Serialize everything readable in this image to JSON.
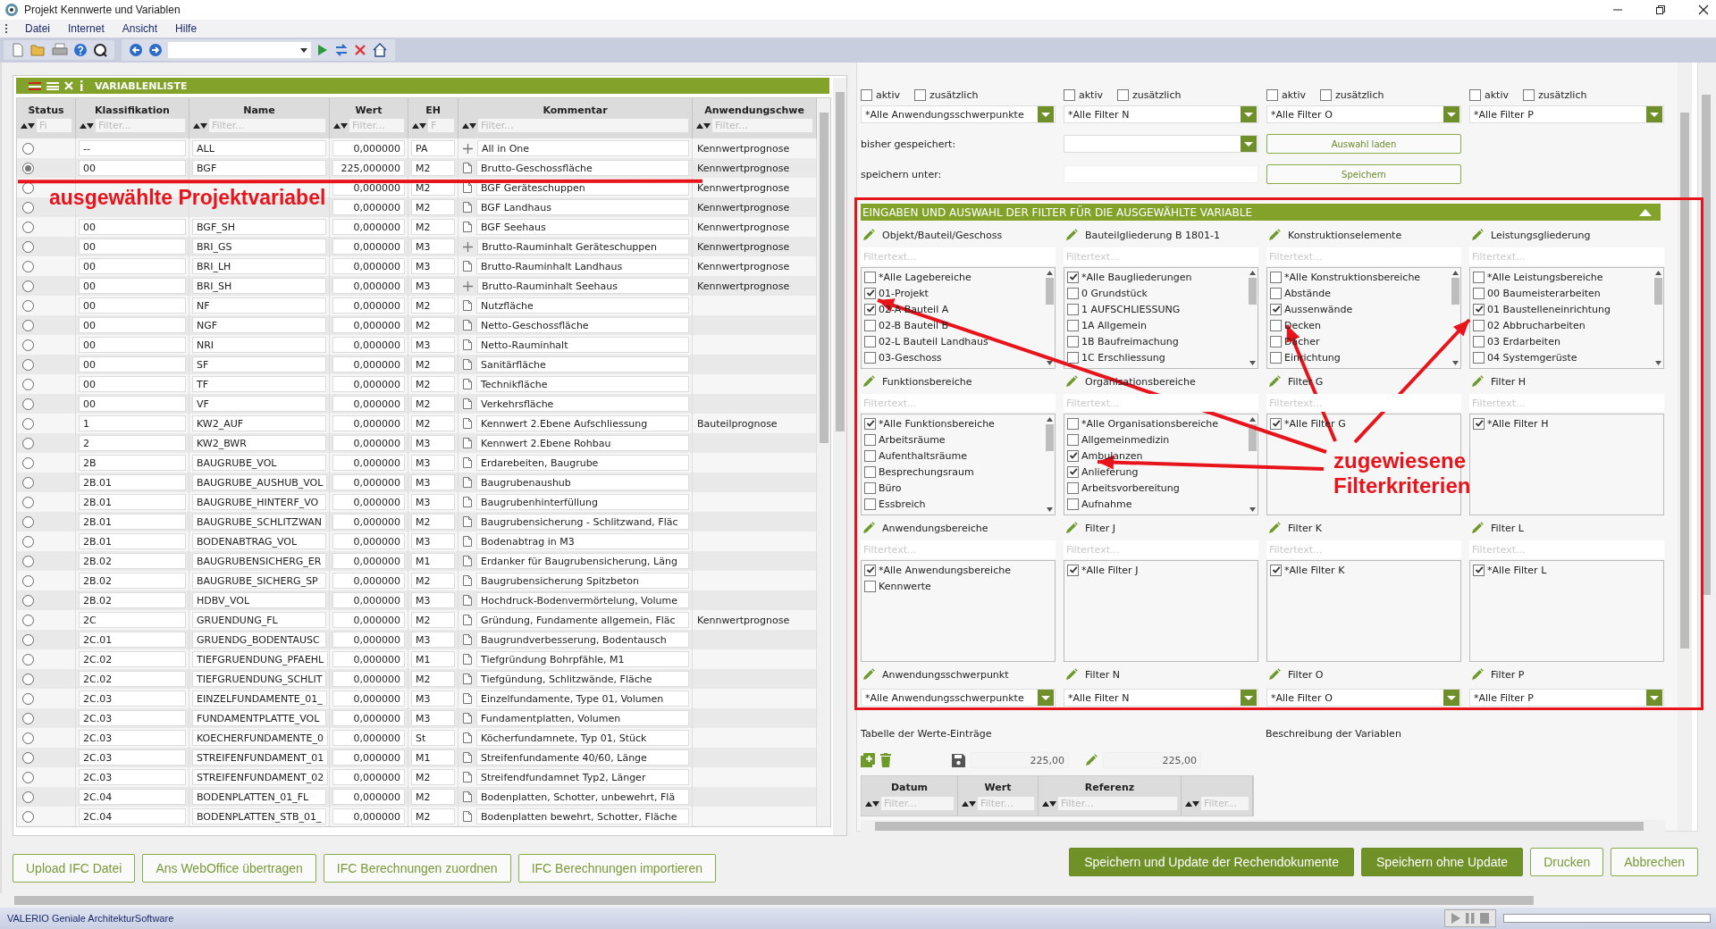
{
  "window": {
    "title": "Projekt Kennwerte und Variablen"
  },
  "menu": [
    "Datei",
    "Internet",
    "Ansicht",
    "Hilfe"
  ],
  "variable_list": {
    "title": "VARIABLENLISTE",
    "columns": [
      {
        "label": "Status",
        "placeholder": "Fi"
      },
      {
        "label": "Klassifikation",
        "placeholder": "Filter..."
      },
      {
        "label": "Name",
        "placeholder": "Filter..."
      },
      {
        "label": "Wert",
        "placeholder": "Filter..."
      },
      {
        "label": "EH",
        "placeholder": "F"
      },
      {
        "label": "Kommentar",
        "placeholder": "Filter..."
      },
      {
        "label": "Anwendungschwe",
        "placeholder": "Filter..."
      }
    ],
    "rows": [
      {
        "selected": false,
        "classification": "--",
        "name": "ALL",
        "value": "0,000000",
        "unit": "PA",
        "kind": "plus",
        "comment": "All in One",
        "application": "Kennwertprognose"
      },
      {
        "selected": true,
        "classification": "00",
        "name": "BGF",
        "value": "225,000000",
        "unit": "M2",
        "kind": "page",
        "comment": "Brutto-Geschossfläche",
        "application": "Kennwertprognose"
      },
      {
        "selected": false,
        "value": "0,000000",
        "unit": "M2",
        "kind": "page",
        "comment": "BGF Geräteschuppen",
        "application": "Kennwertprognose"
      },
      {
        "selected": false,
        "value": "0,000000",
        "unit": "M2",
        "kind": "page",
        "comment": "BGF Landhaus",
        "application": "Kennwertprognose"
      },
      {
        "selected": false,
        "classification": "00",
        "name": "BGF_SH",
        "value": "0,000000",
        "unit": "M2",
        "kind": "page",
        "comment": "BGF Seehaus",
        "application": "Kennwertprognose"
      },
      {
        "selected": false,
        "classification": "00",
        "name": "BRI_GS",
        "value": "0,000000",
        "unit": "M3",
        "kind": "plus",
        "comment": "Brutto-Rauminhalt Geräteschuppen",
        "application": "Kennwertprognose"
      },
      {
        "selected": false,
        "classification": "00",
        "name": "BRI_LH",
        "value": "0,000000",
        "unit": "M3",
        "kind": "page",
        "comment": "Brutto-Rauminhalt Landhaus",
        "application": "Kennwertprognose"
      },
      {
        "selected": false,
        "classification": "00",
        "name": "BRI_SH",
        "value": "0,000000",
        "unit": "M3",
        "kind": "plus",
        "comment": "Brutto-Rauminhalt Seehaus",
        "application": "Kennwertprognose"
      },
      {
        "selected": false,
        "classification": "00",
        "name": "NF",
        "value": "0,000000",
        "unit": "M2",
        "kind": "page",
        "comment": "Nutzfläche"
      },
      {
        "selected": false,
        "classification": "00",
        "name": "NGF",
        "value": "0,000000",
        "unit": "M2",
        "kind": "page",
        "comment": "Netto-Geschossfläche"
      },
      {
        "selected": false,
        "classification": "00",
        "name": "NRI",
        "value": "0,000000",
        "unit": "M3",
        "kind": "page",
        "comment": "Netto-Rauminhalt"
      },
      {
        "selected": false,
        "classification": "00",
        "name": "SF",
        "value": "0,000000",
        "unit": "M2",
        "kind": "page",
        "comment": "Sanitärfläche"
      },
      {
        "selected": false,
        "classification": "00",
        "name": "TF",
        "value": "0,000000",
        "unit": "M2",
        "kind": "page",
        "comment": "Technikfläche"
      },
      {
        "selected": false,
        "classification": "00",
        "name": "VF",
        "value": "0,000000",
        "unit": "M2",
        "kind": "page",
        "comment": "Verkehrsfläche"
      },
      {
        "selected": false,
        "classification": "1",
        "name": "KW2_AUF",
        "value": "0,000000",
        "unit": "M2",
        "kind": "page",
        "comment": "Kennwert 2.Ebene Aufschliessung",
        "application": "Bauteilprognose"
      },
      {
        "selected": false,
        "classification": "2",
        "name": "KW2_BWR",
        "value": "0,000000",
        "unit": "M3",
        "kind": "page",
        "comment": "Kennwert 2.Ebene Rohbau"
      },
      {
        "selected": false,
        "classification": "2B",
        "name": "BAUGRUBE_VOL",
        "value": "0,000000",
        "unit": "M3",
        "kind": "page",
        "comment": "Erdarebeiten, Baugrube"
      },
      {
        "selected": false,
        "classification": "2B.01",
        "name": "BAUGRUBE_AUSHUB_VOL",
        "value": "0,000000",
        "unit": "M3",
        "kind": "page",
        "comment": "Baugrubenaushub"
      },
      {
        "selected": false,
        "classification": "2B.01",
        "name": "BAUGRUBE_HINTERF_VO",
        "value": "0,000000",
        "unit": "M3",
        "kind": "page",
        "comment": "Baugrubenhinterfüllung"
      },
      {
        "selected": false,
        "classification": "2B.01",
        "name": "BAUGRUBE_SCHLITZWAN",
        "value": "0,000000",
        "unit": "M2",
        "kind": "page",
        "comment": "Baugrubensicherung - Schlitzwand, Fläc"
      },
      {
        "selected": false,
        "classification": "2B.01",
        "name": "BODENABTRAG_VOL",
        "value": "0,000000",
        "unit": "M3",
        "kind": "page",
        "comment": "Bodenabtrag in M3"
      },
      {
        "selected": false,
        "classification": "2B.02",
        "name": "BAUGRUBENSICHERG_ER",
        "value": "0,000000",
        "unit": "M1",
        "kind": "page",
        "comment": "Erdanker für Baugrubensicherung, Läng"
      },
      {
        "selected": false,
        "classification": "2B.02",
        "name": "BAUGRUBE_SICHERG_SP",
        "value": "0,000000",
        "unit": "M2",
        "kind": "page",
        "comment": "Baugrubensicherung Spitzbeton"
      },
      {
        "selected": false,
        "classification": "2B.02",
        "name": "HDBV_VOL",
        "value": "0,000000",
        "unit": "M3",
        "kind": "page",
        "comment": "Hochdruck-Bodenvermörtelung, Volume"
      },
      {
        "selected": false,
        "classification": "2C",
        "name": "GRUENDUNG_FL",
        "value": "0,000000",
        "unit": "M2",
        "kind": "page",
        "comment": "Gründung, Fundamente allgemein, Fläc",
        "application": "Kennwertprognose"
      },
      {
        "selected": false,
        "classification": "2C.01",
        "name": "GRUENDG_BODENTAUSC",
        "value": "0,000000",
        "unit": "M3",
        "kind": "page",
        "comment": "Baugrundverbesserung, Bodentausch"
      },
      {
        "selected": false,
        "classification": "2C.02",
        "name": "TIEFGRUENDUNG_PFAEHL",
        "value": "0,000000",
        "unit": "M1",
        "kind": "page",
        "comment": "Tiefgründung Bohrpfähle, M1"
      },
      {
        "selected": false,
        "classification": "2C.02",
        "name": "TIEFGRUENDUNG_SCHLIT",
        "value": "0,000000",
        "unit": "M2",
        "kind": "page",
        "comment": "Tiefgündung, Schlitzwände, Fläche"
      },
      {
        "selected": false,
        "classification": "2C.03",
        "name": "EINZELFUNDAMENTE_01_",
        "value": "0,000000",
        "unit": "M3",
        "kind": "page",
        "comment": "Einzelfundamente, Type 01, Volumen"
      },
      {
        "selected": false,
        "classification": "2C.03",
        "name": "FUNDAMENTPLATTE_VOL",
        "value": "0,000000",
        "unit": "M3",
        "kind": "page",
        "comment": "Fundamentplatten, Volumen"
      },
      {
        "selected": false,
        "classification": "2C.03",
        "name": "KOECHERFUNDAMENTE_0",
        "value": "0,000000",
        "unit": "St",
        "kind": "page",
        "comment": "Köcherfundamnete, Typ 01, Stück"
      },
      {
        "selected": false,
        "classification": "2C.03",
        "name": "STREIFENFUNDAMENT_01",
        "value": "0,000000",
        "unit": "M1",
        "kind": "page",
        "comment": "Streifenfundamente 40/60, Länge"
      },
      {
        "selected": false,
        "classification": "2C.03",
        "name": "STREIFENFUNDAMENT_02",
        "value": "0,000000",
        "unit": "M2",
        "kind": "page",
        "comment": "Streifendfundamnet Typ2, Länger"
      },
      {
        "selected": false,
        "classification": "2C.04",
        "name": "BODENPLATTEN_01_FL",
        "value": "0,000000",
        "unit": "M2",
        "kind": "page",
        "comment": "Bodenplatten, Schotter, unbewehrt, Flä"
      },
      {
        "selected": false,
        "classification": "2C.04",
        "name": "BODENPLATTEN_STB_01_",
        "value": "0,000000",
        "unit": "M2",
        "kind": "page",
        "comment": "Bodenplatten bewehrt, Schotter, Fläche"
      }
    ]
  },
  "left_buttons": [
    "Upload IFC Datei",
    "Ans WebOffice übertragen",
    "IFC Berechnungen zuordnen",
    "IFC Berechnungen importieren"
  ],
  "top_filters": [
    {
      "aktiv": {
        "label": "aktiv",
        "checked": false
      },
      "additional": {
        "label": "zusätzlich",
        "checked": false
      },
      "value": "*Alle Anwendungsschwerpunkte"
    },
    {
      "aktiv": {
        "label": "aktiv",
        "checked": false
      },
      "additional": {
        "label": "zusätzlich",
        "checked": false
      },
      "value": "*Alle Filter N"
    },
    {
      "aktiv": {
        "label": "aktiv",
        "checked": false
      },
      "additional": {
        "label": "zusätzlich",
        "checked": false
      },
      "value": "*Alle Filter O"
    },
    {
      "aktiv": {
        "label": "aktiv",
        "checked": false
      },
      "additional": {
        "label": "zusätzlich",
        "checked": false
      },
      "value": "*Alle Filter P"
    }
  ],
  "saved": {
    "label": "bisher gespeichert:",
    "button": "Auswahl laden"
  },
  "save_as": {
    "label": "speichern unter:",
    "button": "Speichern"
  },
  "filter_section": {
    "title": "EINGABEN UND AUSWAHL DER FILTER FÜR DIE AUSGEWÄHLTE VARIABLE",
    "lists": [
      {
        "title": "Objekt/Bauteil/Geschoss",
        "placeholder": "Filtertext...",
        "scrollable": true,
        "items": [
          {
            "label": "*Alle Lagebereiche",
            "checked": false
          },
          {
            "label": "01-Projekt",
            "checked": true
          },
          {
            "label": "02-A Bauteil A",
            "checked": true
          },
          {
            "label": "02-B Bauteil B",
            "checked": false
          },
          {
            "label": "02-L Bauteil Landhaus",
            "checked": false
          },
          {
            "label": "03-Geschoss",
            "checked": false
          }
        ]
      },
      {
        "title": "Bauteilgliederung B 1801-1",
        "placeholder": "Filtertext...",
        "scrollable": true,
        "items": [
          {
            "label": "*Alle Baugliederungen",
            "checked": true
          },
          {
            "label": "0 Grundstück",
            "checked": false
          },
          {
            "label": "1 AUFSCHLIESSUNG",
            "checked": false
          },
          {
            "label": "1A Allgemein",
            "checked": false
          },
          {
            "label": "1B Baufreimachung",
            "checked": false
          },
          {
            "label": "1C Erschliessung",
            "checked": false
          }
        ]
      },
      {
        "title": "Konstruktionselemente",
        "placeholder": "Filtertext...",
        "scrollable": true,
        "items": [
          {
            "label": "*Alle Konstruktionsbereiche",
            "checked": false
          },
          {
            "label": "Abstände",
            "checked": false
          },
          {
            "label": "Aussenwände",
            "checked": true
          },
          {
            "label": "Decken",
            "checked": false
          },
          {
            "label": "Dächer",
            "checked": false
          },
          {
            "label": "Einrichtung",
            "checked": false
          }
        ]
      },
      {
        "title": "Leistungsgliederung",
        "placeholder": "Filtertext...",
        "scrollable": true,
        "items": [
          {
            "label": "*Alle Leistungsbereiche",
            "checked": false
          },
          {
            "label": "00 Baumeisterarbeiten",
            "checked": false
          },
          {
            "label": "01 Baustelleneinrichtung",
            "checked": true
          },
          {
            "label": "02 Abbrucharbeiten",
            "checked": false
          },
          {
            "label": "03 Erdarbeiten",
            "checked": false
          },
          {
            "label": "04 Systemgerüste",
            "checked": false
          }
        ]
      },
      {
        "title": "Funktionsbereiche",
        "placeholder": "Filtertext...",
        "scrollable": true,
        "items": [
          {
            "label": "*Alle Funktionsbereiche",
            "checked": true
          },
          {
            "label": "Arbeitsräume",
            "checked": false
          },
          {
            "label": "Aufenthaltsräume",
            "checked": false
          },
          {
            "label": "Besprechungsraum",
            "checked": false
          },
          {
            "label": "Büro",
            "checked": false
          },
          {
            "label": "Essbreich",
            "checked": false
          }
        ]
      },
      {
        "title": "Organisationsbereiche",
        "placeholder": "Filtertext...",
        "scrollable": true,
        "items": [
          {
            "label": "*Alle Organisationsbereiche",
            "checked": false
          },
          {
            "label": "Allgemeinmedizin",
            "checked": false
          },
          {
            "label": "Ambulanzen",
            "checked": true
          },
          {
            "label": "Anlieferung",
            "checked": true
          },
          {
            "label": "Arbeitsvorbereitung",
            "checked": false
          },
          {
            "label": "Aufnahme",
            "checked": false
          }
        ]
      },
      {
        "title": "Filter G",
        "placeholder": "Filtertext...",
        "scrollable": false,
        "items": [
          {
            "label": "*Alle Filter G",
            "checked": true
          }
        ]
      },
      {
        "title": "Filter H",
        "placeholder": "Filtertext...",
        "scrollable": false,
        "items": [
          {
            "label": "*Alle Filter H",
            "checked": true
          }
        ]
      },
      {
        "title": "Anwendungsbereiche",
        "placeholder": "Filtertext...",
        "scrollable": false,
        "items": [
          {
            "label": "*Alle Anwendungsbereiche",
            "checked": true
          },
          {
            "label": "Kennwerte",
            "checked": false
          }
        ]
      },
      {
        "title": "Filter J",
        "placeholder": "Filtertext...",
        "scrollable": false,
        "items": [
          {
            "label": "*Alle Filter J",
            "checked": true
          }
        ]
      },
      {
        "title": "Filter K",
        "placeholder": "Filtertext...",
        "scrollable": false,
        "items": [
          {
            "label": "*Alle Filter K",
            "checked": true
          }
        ]
      },
      {
        "title": "Filter L",
        "placeholder": "Filtertext...",
        "scrollable": false,
        "items": [
          {
            "label": "*Alle Filter L",
            "checked": true
          }
        ]
      }
    ],
    "dropdowns": [
      {
        "title": "Anwendungsschwerpunkt",
        "value": "*Alle Anwendungsschwerpunkte"
      },
      {
        "title": "Filter N",
        "value": "*Alle Filter N"
      },
      {
        "title": "Filter O",
        "value": "*Alle Filter O"
      },
      {
        "title": "Filter P",
        "value": "*Alle Filter P"
      }
    ]
  },
  "values": {
    "title": "Tabelle der Werte-Einträge",
    "description_title": "Beschreibung der Variablen",
    "saved_value": "225,00",
    "edit_value": "225,00",
    "columns": [
      {
        "label": "Datum",
        "placeholder": "Filter..."
      },
      {
        "label": "Wert",
        "placeholder": "Filter..."
      },
      {
        "label": "Referenz",
        "placeholder": "Filter..."
      },
      {
        "placeholder": "Filter..."
      }
    ]
  },
  "right_buttons": [
    {
      "label": "Speichern und Update der Rechendokumente",
      "kind": "primary"
    },
    {
      "label": "Speichern ohne Update",
      "kind": "primary"
    },
    {
      "label": "Drucken",
      "kind": "secondary"
    },
    {
      "label": "Abbrechen",
      "kind": "secondary"
    }
  ],
  "annotations": {
    "label": "ausgewählte Projektvariabel",
    "callout": "zugewiesene Filterkriterien"
  },
  "status_bar": {
    "text": "VALERIO Geniale ArchitekturSoftware"
  }
}
